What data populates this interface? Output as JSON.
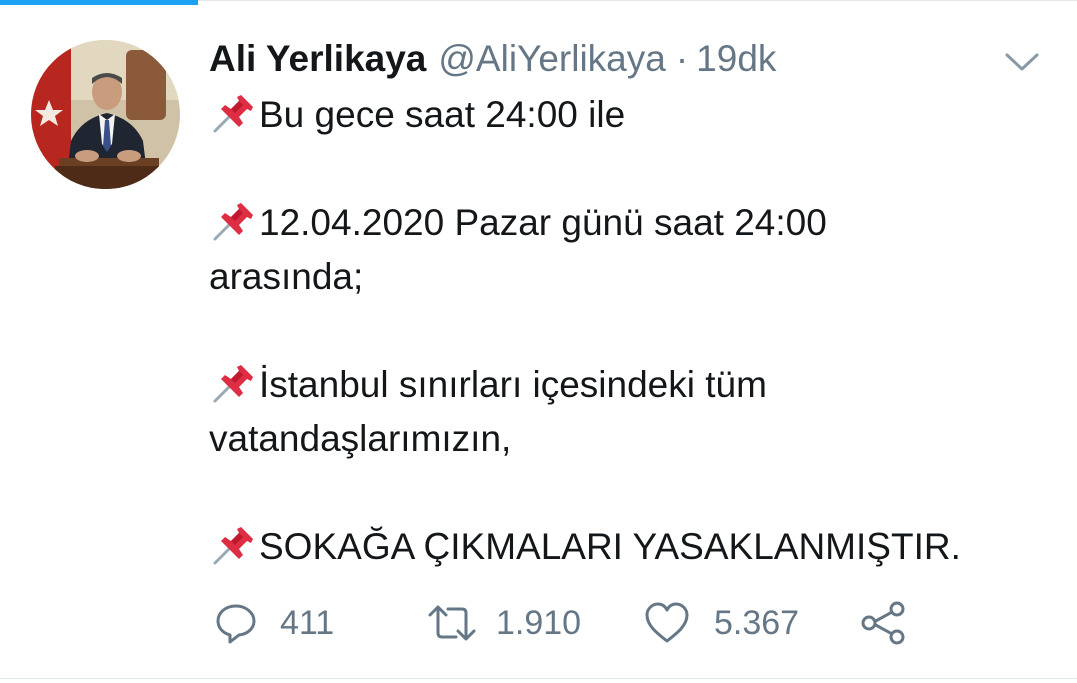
{
  "tweet": {
    "author_name": "Ali Yerlikaya",
    "author_handle": "@AliYerlikaya",
    "separator": "·",
    "time_ago": "19dk",
    "paragraphs": [
      [
        "Bu gece saat 24:00 ile"
      ],
      [
        "12.04.2020 Pazar günü saat 24:00",
        "arasında;"
      ],
      [
        "İstanbul  sınırları içesindeki tüm",
        "vatandaşlarımızın,"
      ],
      [
        "SOKAĞA ÇIKMALARI YASAKLANMIŞTIR."
      ]
    ],
    "paragraph_icon": "pushpin-icon"
  },
  "actions": {
    "reply_count": "411",
    "retweet_count": "1.910",
    "like_count": "5.367"
  },
  "icons": {
    "reply": "reply-icon",
    "retweet": "retweet-icon",
    "like": "heart-icon",
    "share": "share-icon",
    "menu": "chevron-down-icon"
  },
  "colors": {
    "accent": "#1da1f2",
    "text_primary": "#14171a",
    "text_secondary": "#657786",
    "pin_red": "#dd2e44"
  }
}
